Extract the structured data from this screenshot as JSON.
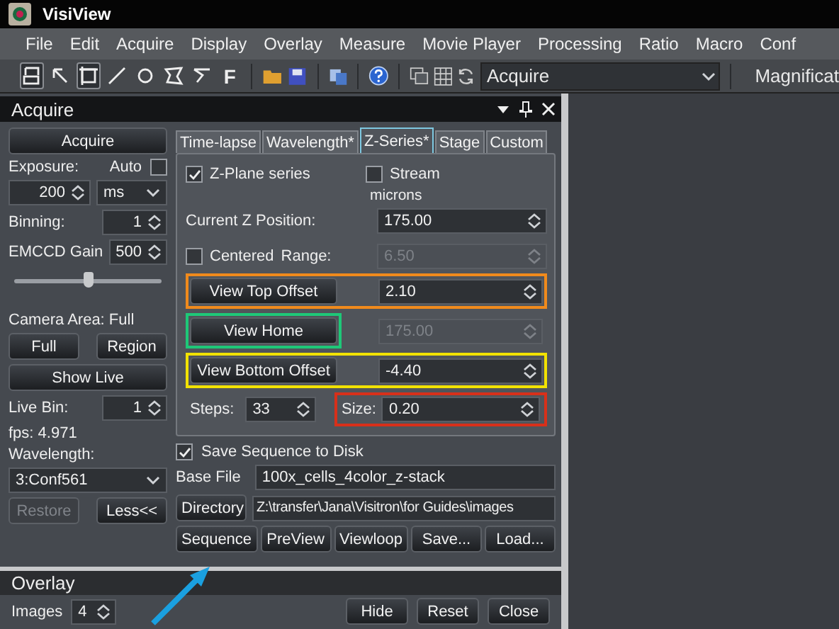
{
  "window": {
    "title": "VisiView"
  },
  "menu": [
    "File",
    "Edit",
    "Acquire",
    "Display",
    "Overlay",
    "Measure",
    "Movie Player",
    "Processing",
    "Ratio",
    "Macro",
    "Conf"
  ],
  "toolbar": {
    "tools": [
      {
        "kind": "select",
        "selected": true
      },
      {
        "kind": "pointer",
        "selected": false
      },
      {
        "kind": "rectangle",
        "selected": true
      },
      {
        "kind": "line",
        "selected": false
      },
      {
        "kind": "ellipse",
        "selected": false
      },
      {
        "kind": "polygon",
        "selected": false
      },
      {
        "kind": "polyline",
        "selected": false
      },
      {
        "kind": "text",
        "label": "F",
        "selected": false
      }
    ],
    "combo": "Acquire",
    "magnification": "Magnificat"
  },
  "dock": {
    "title": "Acquire",
    "left": {
      "acquire": "Acquire",
      "exposure_label": "Exposure:",
      "auto_label": "Auto",
      "auto_checked": false,
      "exposure": "200",
      "unit": "ms",
      "binning_label": "Binning:",
      "binning": "1",
      "gain_label": "EMCCD Gain",
      "gain": "500",
      "gain_slider": {
        "level": 0.5
      },
      "camera_area": "Camera Area: Full",
      "full": "Full",
      "region": "Region",
      "show_live": "Show Live",
      "live_bin_label": "Live Bin:",
      "live_bin": "1",
      "fps": "fps: 4.971",
      "wavelength_label": "Wavelength:",
      "wavelength": "3:Conf561",
      "restore": {
        "label": "Restore",
        "disabled": true
      },
      "less": "Less<<"
    },
    "tabs": [
      {
        "label": "Time-lapse",
        "selected": false
      },
      {
        "label": "Wavelength*",
        "selected": false
      },
      {
        "label": "Z-Series*",
        "selected": true
      },
      {
        "label": "Stage",
        "selected": false
      },
      {
        "label": "Custom",
        "selected": false
      }
    ],
    "z_series": {
      "z_plane": {
        "label": "Z-Plane series",
        "checked": true
      },
      "stream": {
        "label": "Stream",
        "checked": false
      },
      "units": "microns",
      "current_label": "Current Z Position:",
      "current": "175.00",
      "centered": {
        "label": "Centered",
        "checked": false
      },
      "range_label": "Range:",
      "range": {
        "value": "6.50",
        "disabled": true
      },
      "offset_rows": [
        {
          "kind": "row",
          "button": "View Top Offset",
          "value": "2.10",
          "disabled": false,
          "color": "#f08a1c"
        },
        {
          "kind": "button",
          "button": "View Home",
          "value": "175.00",
          "disabled": true,
          "color": "#1ec878"
        },
        {
          "kind": "row",
          "button": "View Bottom Offset",
          "value": "-4.40",
          "disabled": false,
          "color": "#f2e200"
        }
      ],
      "steps_label": "Steps:",
      "steps": "33",
      "size": {
        "label": "Size:",
        "value": "0.20",
        "color": "#d8301a"
      }
    },
    "save": {
      "label": "Save Sequence to Disk",
      "checked": true
    },
    "base_label": "Base File",
    "base_file": "100x_cells_4color_z-stack",
    "directory": "Directory",
    "path": "Z:\\transfer\\Jana\\Visitron\\for Guides\\images",
    "actions": [
      "Sequence",
      "PreView",
      "Viewloop",
      "Save...",
      "Load..."
    ]
  },
  "overlay": {
    "title": "Overlay",
    "images_label": "Images",
    "images": "4",
    "buttons": [
      "Hide",
      "Reset",
      "Close"
    ]
  }
}
